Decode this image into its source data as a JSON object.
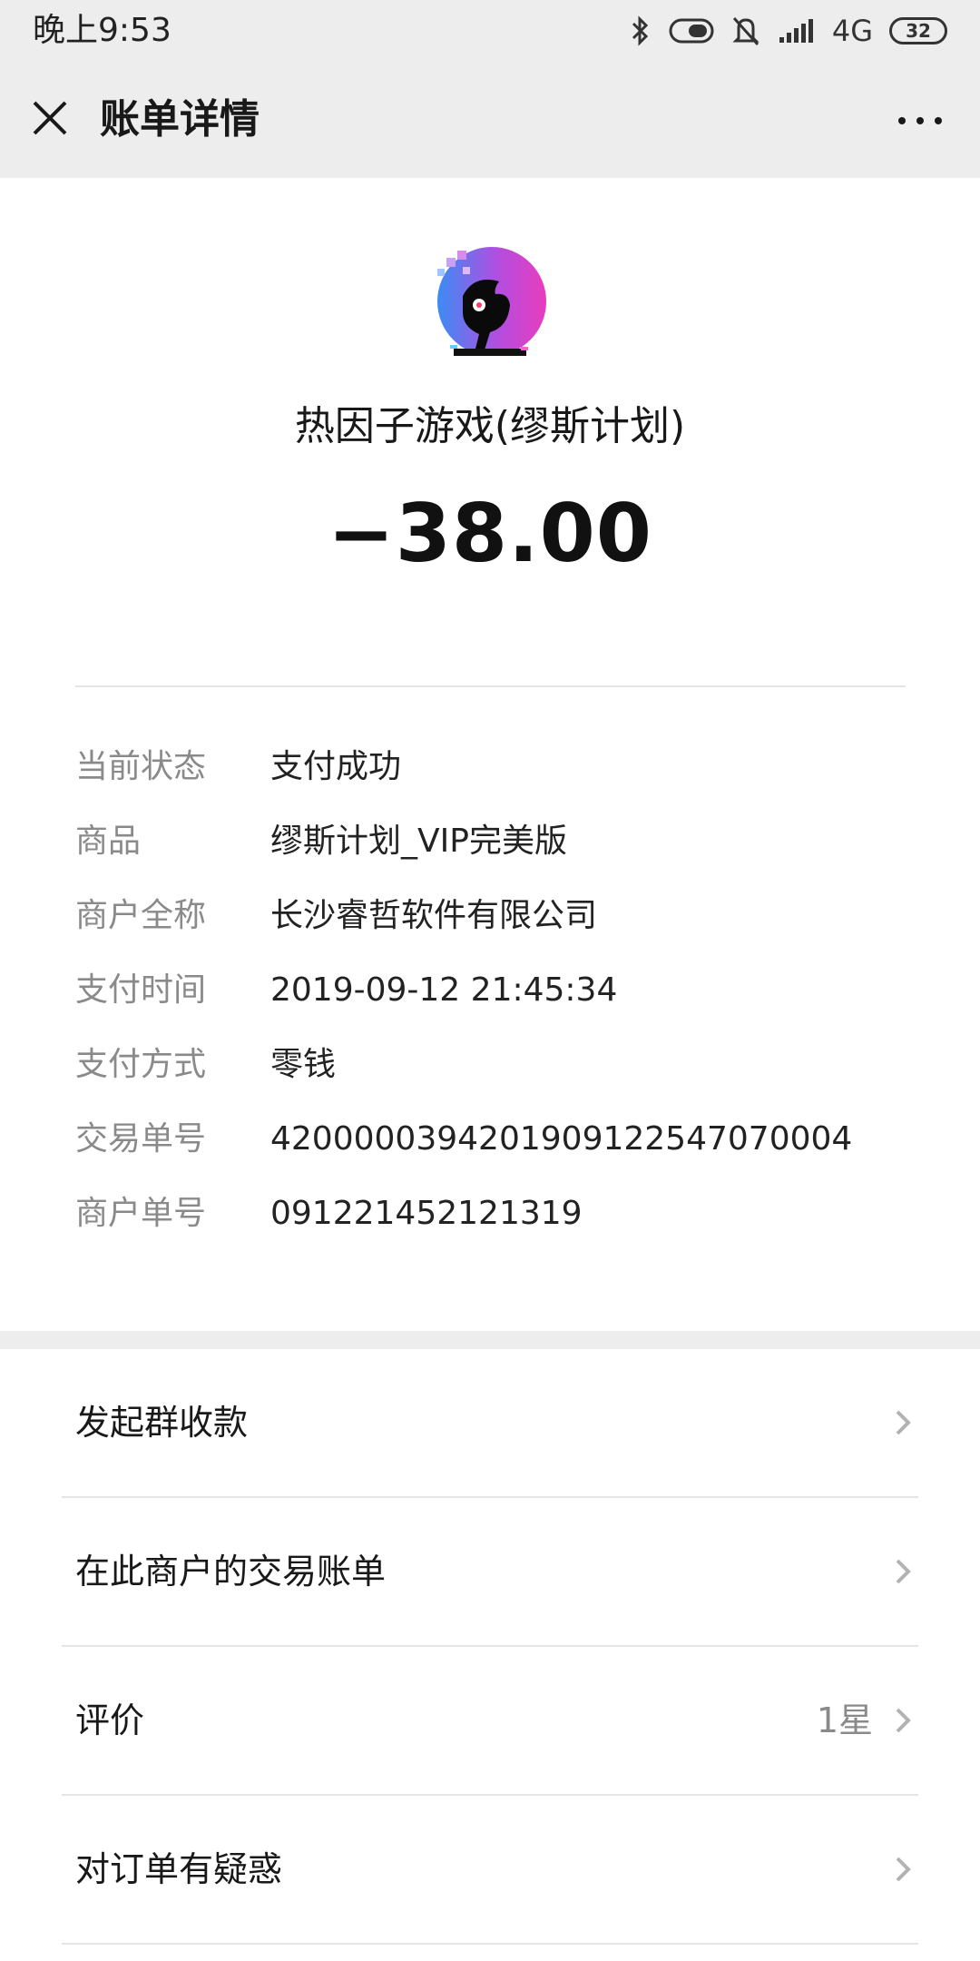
{
  "status_bar": {
    "time": "晚上9:53",
    "network": "4G",
    "battery": "32"
  },
  "header": {
    "title": "账单详情"
  },
  "merchant": {
    "name": "热因子游戏(缪斯计划)",
    "amount": "−38.00"
  },
  "details": [
    {
      "label": "当前状态",
      "value": "支付成功"
    },
    {
      "label": "商品",
      "value": "缪斯计划_VIP完美版"
    },
    {
      "label": "商户全称",
      "value": "长沙睿哲软件有限公司"
    },
    {
      "label": "支付时间",
      "value": "2019-09-12 21:45:34"
    },
    {
      "label": "支付方式",
      "value": "零钱"
    },
    {
      "label": "交易单号",
      "value": "4200000394201909122547070004"
    },
    {
      "label": "商户单号",
      "value": "091221452121319"
    }
  ],
  "actions": [
    {
      "label": "发起群收款",
      "extra": ""
    },
    {
      "label": "在此商户的交易账单",
      "extra": ""
    },
    {
      "label": "评价",
      "extra": "1星"
    },
    {
      "label": "对订单有疑惑",
      "extra": ""
    }
  ],
  "colors": {
    "background": "#ededed",
    "card": "#ffffff",
    "label_gray": "#8a8a8a",
    "text": "#191919",
    "avatar_pink": "#e83dbe",
    "avatar_blue": "#3b8cf5"
  }
}
